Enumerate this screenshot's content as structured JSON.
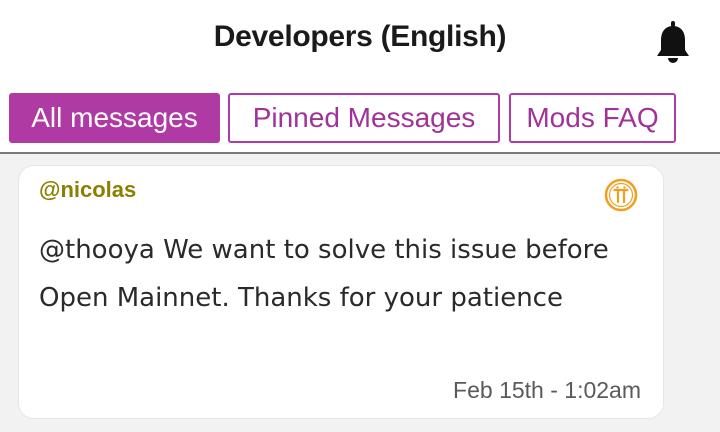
{
  "header": {
    "title": "Developers (English)",
    "icon": "bell-icon"
  },
  "tabs": [
    {
      "label": "All messages",
      "active": true
    },
    {
      "label": "Pinned Messages",
      "active": false
    },
    {
      "label": "Mods FAQ",
      "active": false
    }
  ],
  "message": {
    "author": "@nicolas",
    "badge_icon": "pi-coin-icon",
    "text": "@thooya We want to solve this issue before Open Mainnet. Thanks for your patience",
    "timestamp": "Feb 15th - 1:02am"
  },
  "colors": {
    "accent": "#b03aa4",
    "username": "#8a7f00",
    "badge": "#f0a020"
  }
}
